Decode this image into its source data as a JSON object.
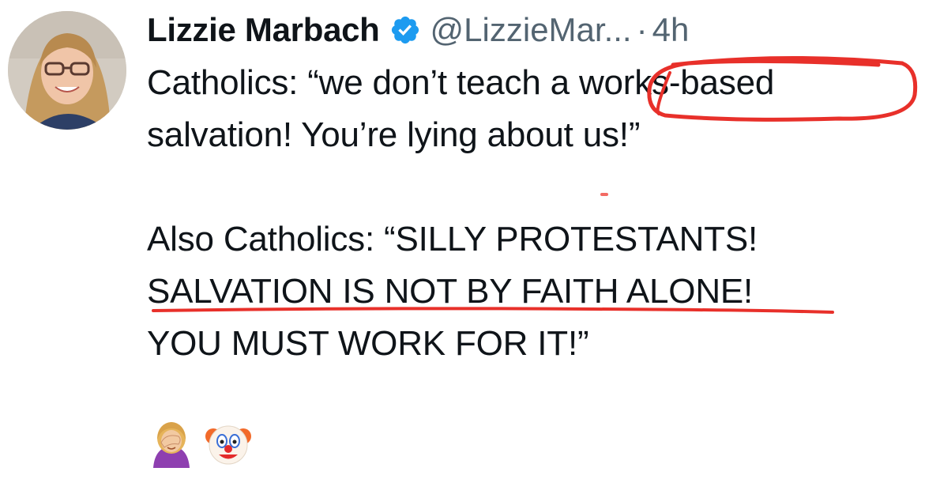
{
  "tweet": {
    "display_name": "Lizzie Marbach",
    "handle": "@LizzieMar...",
    "separator": "·",
    "time": "4h",
    "verified_icon": "verified-badge-icon",
    "verified_color": "#1d9bf0",
    "lines": {
      "l1_pre": "Catholics: “we don’t teach a ",
      "l1_circled": "works-based",
      "l2": "salvation! You’re lying about us!”",
      "l3": "Also Catholics: “SILLY PROTESTANTS!",
      "l4_underlined": "SALVATION IS NOT BY FAITH ALONE!",
      "l5": "YOU MUST WORK FOR IT!”"
    },
    "emojis": [
      "woman-facepalming-icon",
      "clown-face-icon"
    ]
  },
  "annotation_color": "#e8302a"
}
